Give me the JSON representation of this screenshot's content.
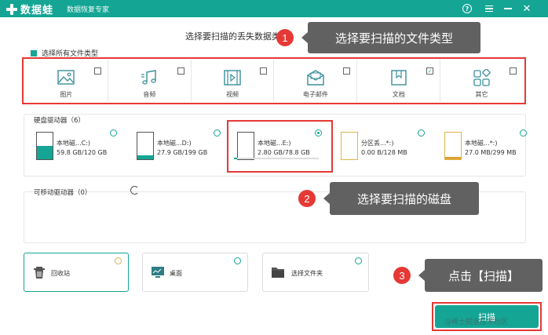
{
  "window": {
    "app_name": "数据蛙",
    "subtitle": "数据恢复专家",
    "help_symbol": "?",
    "close_symbol": "✕"
  },
  "heading": "选择要扫描的丢失数据类型",
  "select_all_label": "选择所有文件类型",
  "file_types": [
    {
      "label": "图片",
      "icon": "image-icon",
      "checked": false
    },
    {
      "label": "音频",
      "icon": "music-icon",
      "checked": false
    },
    {
      "label": "视频",
      "icon": "video-icon",
      "checked": false
    },
    {
      "label": "电子邮件",
      "icon": "email-icon",
      "checked": false
    },
    {
      "label": "文档",
      "icon": "document-icon",
      "checked": true
    },
    {
      "label": "其它",
      "icon": "other-icon",
      "checked": false
    }
  ],
  "hard_drives": {
    "title": "硬盘驱动器（6）",
    "items": [
      {
        "name": "本地磁...C:)",
        "size": "59.8 GB/120 GB",
        "selected": false,
        "used_fraction": 0.5
      },
      {
        "name": "本地磁...D:)",
        "size": "27.9 GB/199 GB",
        "selected": false,
        "used_fraction": 0.14
      },
      {
        "name": "本地磁...E:)",
        "size": "2.80 GB/78.8 GB",
        "selected": true,
        "used_fraction": 0.04
      },
      {
        "name": "分区丢...*:)",
        "size": "0.00  B/128 MB",
        "selected": false,
        "used_fraction": 0.0
      },
      {
        "name": "本地磁...*:)",
        "size": "27.0 MB/299 MB",
        "selected": false,
        "used_fraction": 0.09
      }
    ]
  },
  "removable": {
    "title": "可移动驱动器（0）"
  },
  "locations": [
    {
      "label": "回收站",
      "icon": "recycle-bin-icon"
    },
    {
      "label": "桌面",
      "icon": "desktop-icon"
    },
    {
      "label": "选择文件夹",
      "icon": "folder-icon"
    }
  ],
  "scan_button": "扫描",
  "callouts": [
    {
      "num": "1",
      "text": "选择要扫描的文件类型"
    },
    {
      "num": "2",
      "text": "选择要扫描的磁盘"
    },
    {
      "num": "3",
      "text": "点击【扫描】"
    }
  ],
  "watermark": "@稀土掘金技术社区",
  "colors": {
    "accent": "#14a595",
    "highlight": "#e53935",
    "callout_bg": "#616161"
  }
}
